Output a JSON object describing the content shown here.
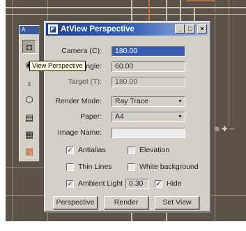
{
  "dialog": {
    "title": "AtView Perspective",
    "window_buttons": {
      "minimize": "_",
      "maximize": "□",
      "close": "×"
    }
  },
  "toolbar": {
    "title_icon": "A",
    "tooltip": "View Perspective",
    "tools": [
      {
        "icon": "camera-icon",
        "glyph": "◘"
      },
      {
        "icon": "perspective-icon",
        "glyph": "◉"
      },
      {
        "icon": "light-bulb-icon",
        "glyph": "♁"
      },
      {
        "icon": "cube-icon",
        "glyph": "⬡"
      },
      {
        "icon": "document-icon",
        "glyph": "▤"
      },
      {
        "icon": "grid-icon",
        "glyph": "▦"
      },
      {
        "icon": "render-icon",
        "glyph": "▩"
      }
    ]
  },
  "form": {
    "camera_label": "Camera (C):",
    "camera_value": "180.00",
    "angle_label": "Angle:",
    "angle_value": "60.00",
    "target_label": "Target (T):",
    "target_value": "180.00",
    "render_mode_label": "Render Mode:",
    "render_mode_value": "Ray Trace",
    "paper_label": "Paper:",
    "paper_value": "A4",
    "image_name_label": "Image Name:",
    "image_name_value": "",
    "antialias_label": "Antialias",
    "elevation_label": "Elevation",
    "thin_lines_label": "Thin Lines",
    "white_background_label": "White background",
    "ambient_light_label": "Ambient Light",
    "ambient_light_value": "0.30",
    "hide_label": "Hide",
    "check_mark": "✓"
  },
  "buttons": {
    "perspective": "Perspective",
    "render": "Render",
    "set_view": "Set View"
  },
  "corner_icons": "⊕ ✚ ─"
}
